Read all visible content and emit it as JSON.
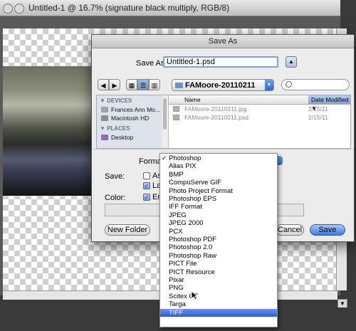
{
  "document_window": {
    "title": "Untitled-1 @ 16.7% (signature black multiply, RGB/8)"
  },
  "dialog": {
    "title": "Save As",
    "save_as_label": "Save As:",
    "filename": "Untitled-1.psd",
    "location": "FAMoore-20110211",
    "sidebar": {
      "devices_header": "DEVICES",
      "devices": [
        "Frances Ann Mo...",
        "Macintosh HD"
      ],
      "places_header": "PLACES",
      "places": [
        "Desktop"
      ]
    },
    "columns": {
      "name": "Name",
      "date_modified": "Date Modified"
    },
    "files": [
      {
        "name": "FAMoore-20110211.jpg",
        "date": "2/15/11"
      },
      {
        "name": "FAMoore-20110211.psd",
        "date": "2/15/11"
      }
    ],
    "format_label": "Format",
    "save_label": "Save:",
    "as_label": "As",
    "layers_label": "Lay",
    "color_label": "Color:",
    "embed_label": "Em",
    "new_folder_button": "New Folder",
    "cancel_button": "Cancel",
    "save_button": "Save"
  },
  "format_menu": {
    "checked_index": 0,
    "highlighted_index": 19,
    "items": [
      "Photoshop",
      "Alias PIX",
      "BMP",
      "CompuServe GIF",
      "Photo Project Format",
      "Photoshop EPS",
      "IFF Format",
      "JPEG",
      "JPEG 2000",
      "PCX",
      "Photoshop PDF",
      "Photoshop 2.0",
      "Photoshop Raw",
      "PICT File",
      "PICT Resource",
      "Pixar",
      "PNG",
      "Scitex CT",
      "Targa",
      "TIFF"
    ]
  },
  "colors": {
    "highlight": "#2b5cd9",
    "accent_blue": "#3b7ce0"
  }
}
